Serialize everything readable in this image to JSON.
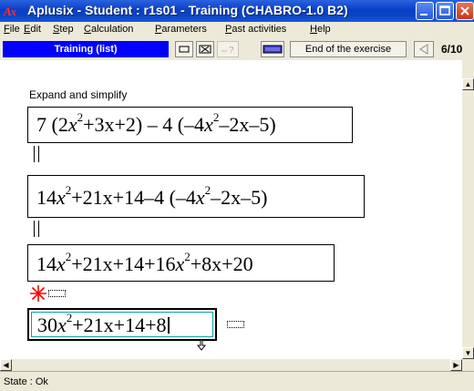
{
  "window": {
    "app_icon": "Ax",
    "title": "Aplusix - Student : r1s01 - Training (CHABRO-1.0 B2)",
    "minimize_icon": "minimize-icon",
    "maximize_icon": "maximize-icon",
    "close_icon": "close-icon"
  },
  "menu": {
    "items": [
      "File",
      "Edit",
      "Step",
      "Calculation",
      "Parameters",
      "Past activities",
      "Help"
    ]
  },
  "toolbar": {
    "mode_label": "Training (list)",
    "end_exercise_label": "End of the exercise",
    "prev_icon": "triangle-left-icon",
    "page": "6/10",
    "help_icon": "help-icon",
    "keyboard_icon": "keyboard-icon"
  },
  "exercise": {
    "instruction": "Expand and simplify",
    "steps": [
      {
        "lead": "7",
        "mid": "2",
        "x2": "x",
        "p2": "2",
        "rest": "+3x+2) – 4 (–4",
        "x2b": "x",
        "p2b": "2",
        "tail": "–2x–5)"
      },
      {
        "lead": "14",
        "x2": "x",
        "p2": "2",
        "rest": "+21x+14–4 (–4",
        "x2b": "x",
        "p2b": "2",
        "tail": "–2x–5)"
      },
      {
        "lead": "14",
        "x2": "x",
        "p2": "2",
        "rest": "+21x+14+16",
        "x2b": "x",
        "p2b": "2",
        "tail": "+8x+20"
      },
      {
        "lead": "30",
        "x2": "x",
        "p2": "2",
        "rest": "+21x+14+8"
      }
    ],
    "error_mark_icon": "asterisk-error-icon"
  },
  "status": {
    "text": "State : Ok"
  },
  "colors": {
    "titlebar": "#0a3ec8",
    "mode_bg": "#0000ff",
    "error_mark": "#ff0000",
    "active_frame": "#10a0a0"
  }
}
